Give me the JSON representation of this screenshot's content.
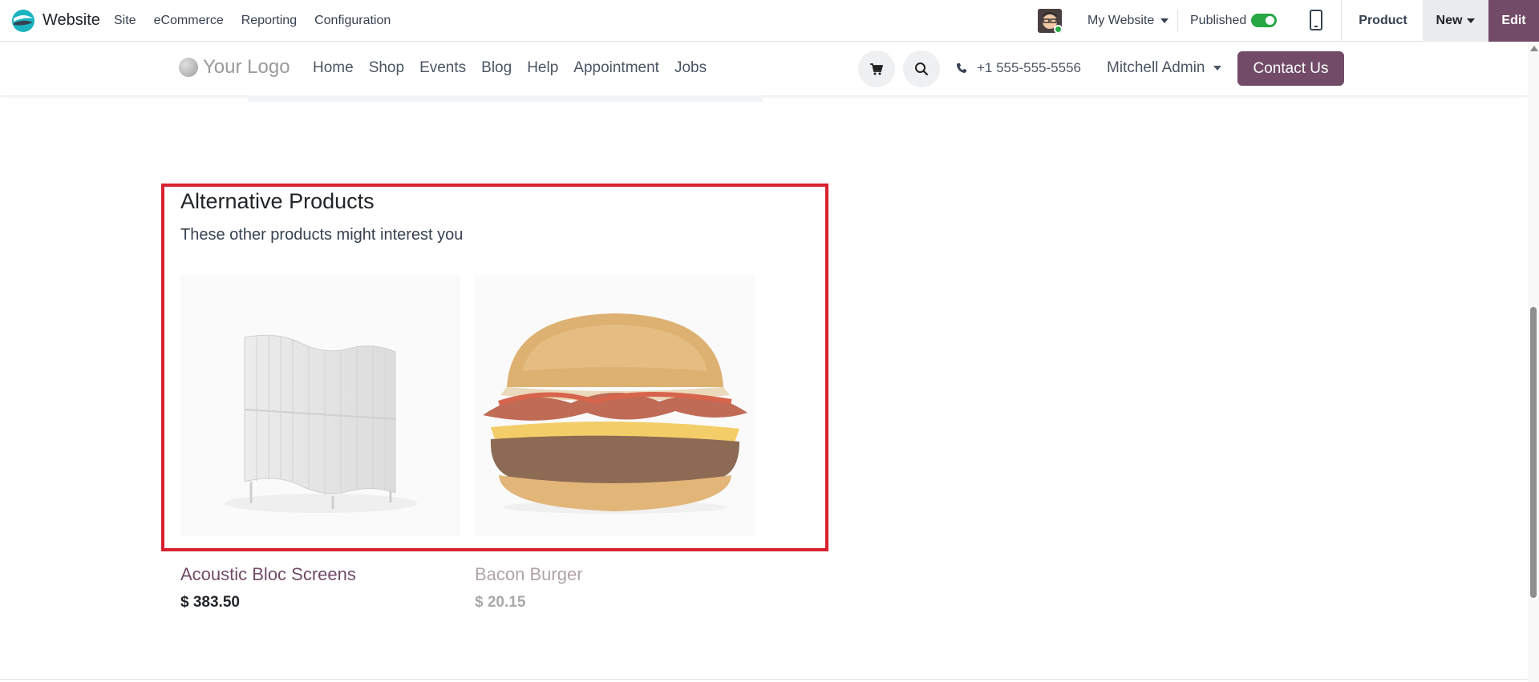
{
  "topbar": {
    "app_name": "Website",
    "menu": [
      "Site",
      "eCommerce",
      "Reporting",
      "Configuration"
    ],
    "website_selector": "My Website",
    "published_label": "Published",
    "published": true,
    "product_label": "Product",
    "new_label": "New",
    "edit_label": "Edit",
    "accent_color": "#714b67"
  },
  "site_header": {
    "logo_text": "Your Logo",
    "nav": [
      "Home",
      "Shop",
      "Events",
      "Blog",
      "Help",
      "Appointment",
      "Jobs"
    ],
    "phone": "+1 555-555-5556",
    "user": "Mitchell Admin",
    "contact_label": "Contact Us"
  },
  "section": {
    "title": "Alternative Products",
    "subtitle": "These other products might interest you",
    "highlight_color": "#d9212f"
  },
  "products": [
    {
      "name": "Acoustic Bloc Screens",
      "price": "$ 383.50",
      "image": "acoustic-screen-image"
    },
    {
      "name": "Bacon Burger",
      "price": "$ 20.15",
      "image": "burger-image"
    }
  ]
}
